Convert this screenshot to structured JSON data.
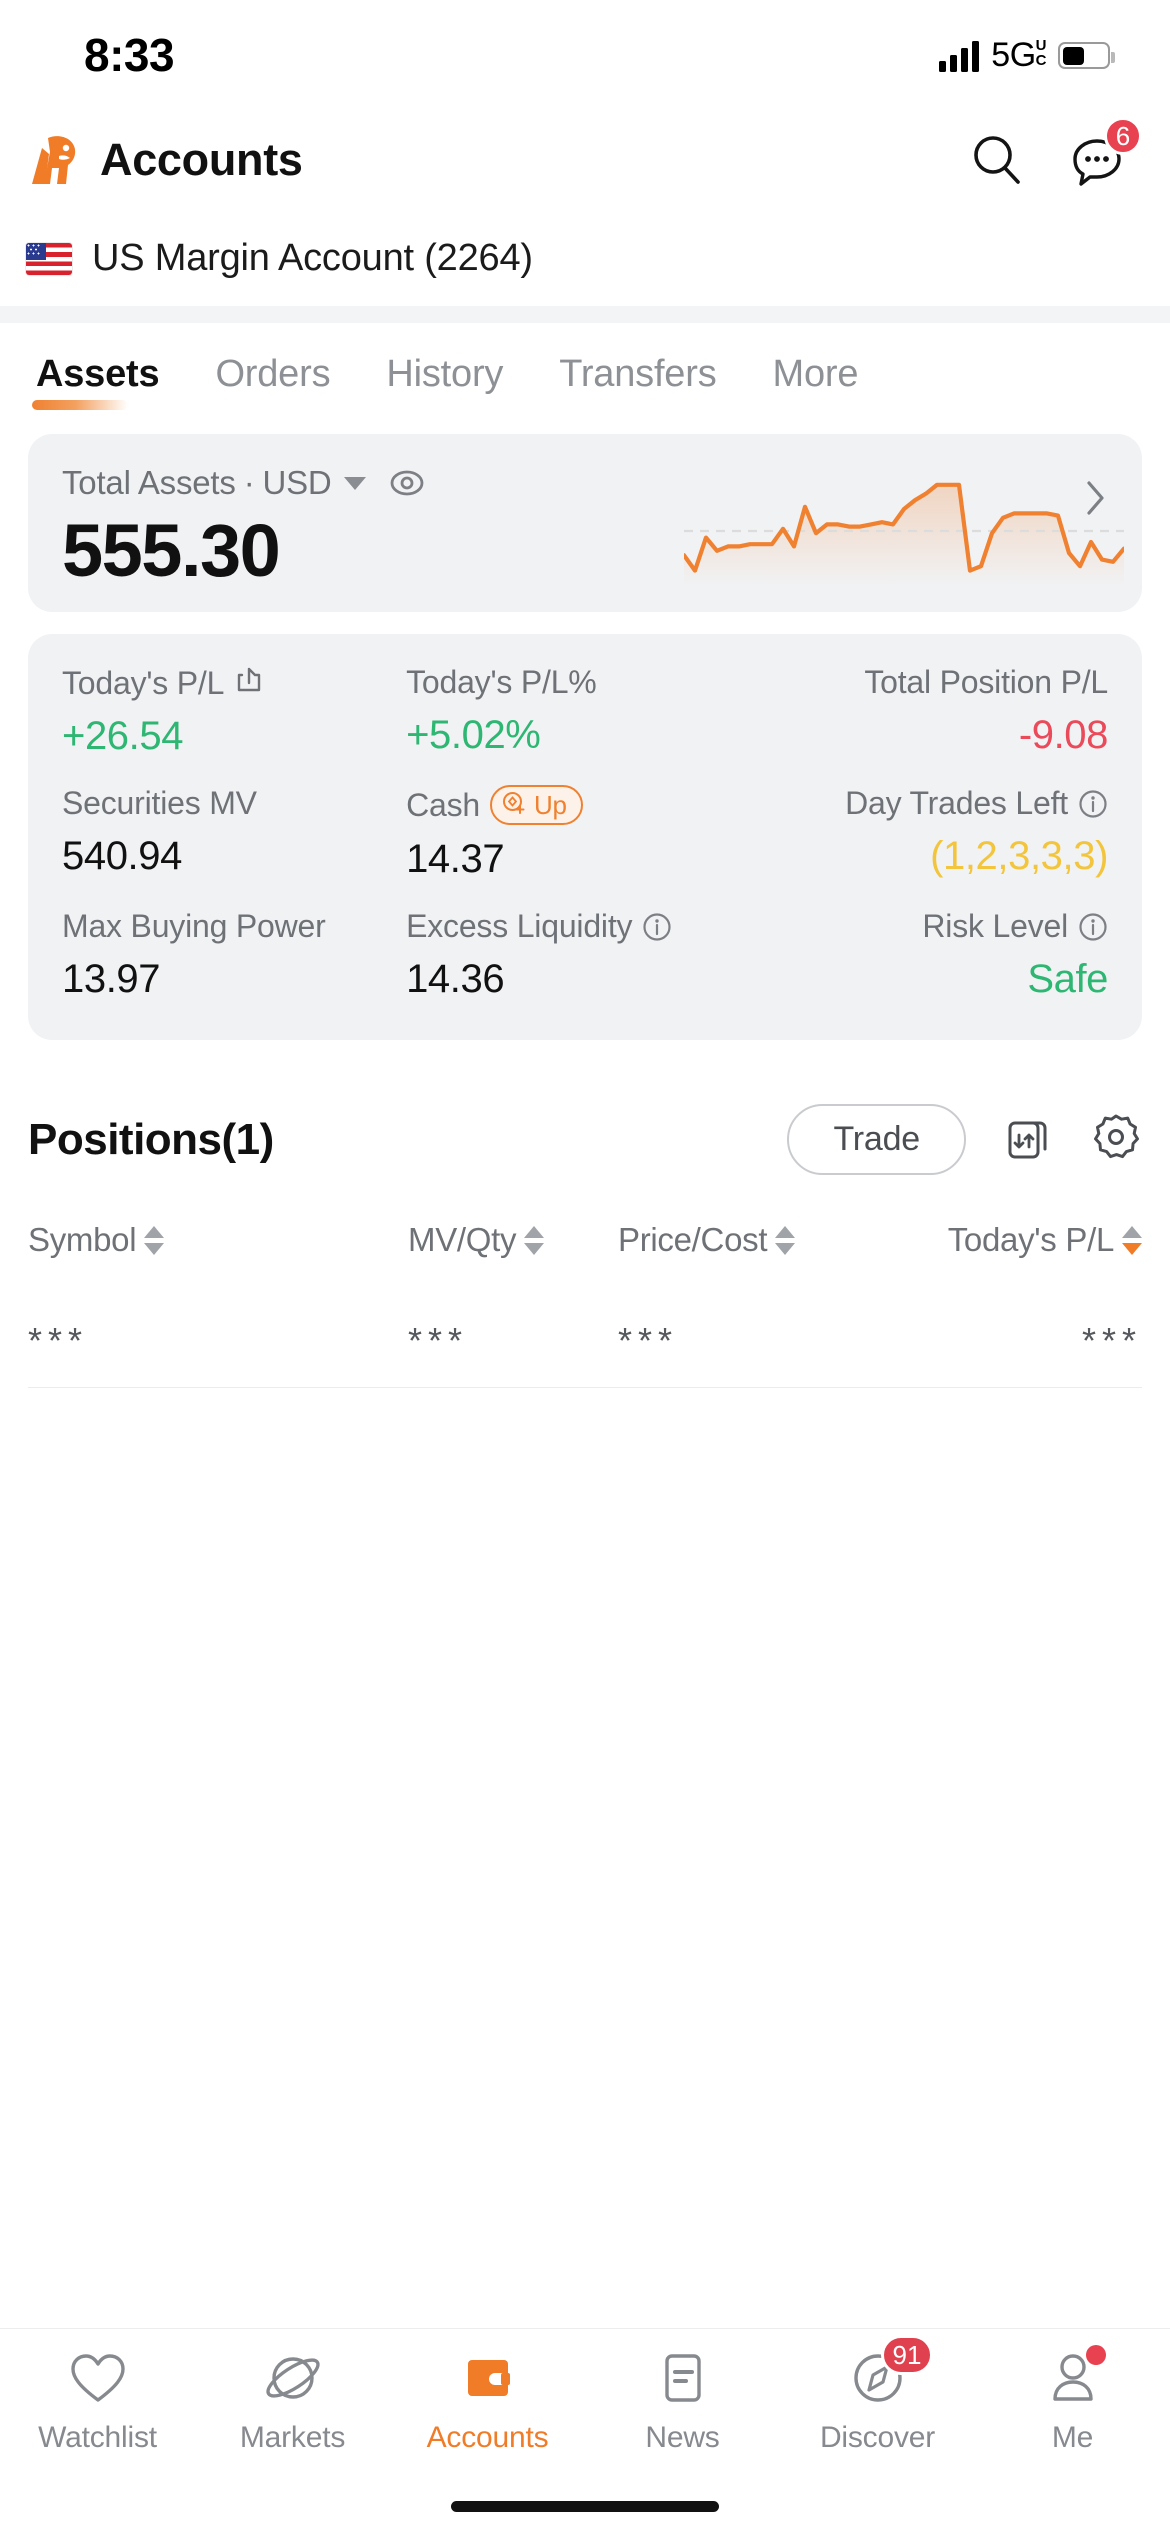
{
  "status_bar": {
    "time": "8:33",
    "network": "5G",
    "network_sup": "U",
    "network_sub": "C",
    "signal_icon": "signal-bars-icon",
    "battery_icon": "battery-icon"
  },
  "header": {
    "title": "Accounts",
    "logo_icon": "bull-logo-icon",
    "search_icon": "search-icon",
    "messages_icon": "chat-bubble-icon",
    "messages_badge": "6"
  },
  "account": {
    "flag_icon": "us-flag-icon",
    "name": "US Margin Account (2264)"
  },
  "tabs": [
    {
      "label": "Assets",
      "active": true
    },
    {
      "label": "Orders",
      "active": false
    },
    {
      "label": "History",
      "active": false
    },
    {
      "label": "Transfers",
      "active": false
    },
    {
      "label": "More",
      "active": false
    }
  ],
  "total_assets": {
    "label": "Total Assets",
    "separator": "·",
    "currency": "USD",
    "currency_caret_icon": "chevron-down-icon",
    "eye_icon": "eye-icon",
    "value": "555.30",
    "chevron_icon": "chevron-right-icon"
  },
  "chart_data": {
    "type": "line",
    "title": "Total Assets Trend",
    "xlabel": "",
    "ylabel": "",
    "grid": false,
    "legend": "none",
    "line_color": "#ef8131",
    "reference_line": {
      "style": "dashed",
      "color": "#dcdcdc",
      "value": 50
    },
    "x": [
      0,
      1,
      2,
      3,
      4,
      5,
      6,
      7,
      8,
      9,
      10,
      11,
      12,
      13,
      14,
      15,
      16,
      17,
      18,
      19,
      20,
      21,
      22,
      23,
      24,
      25,
      26,
      27,
      28,
      29,
      30,
      31,
      32,
      33,
      34,
      35,
      36,
      37,
      38,
      39,
      40
    ],
    "values": [
      28,
      14,
      44,
      32,
      36,
      36,
      38,
      38,
      38,
      52,
      36,
      72,
      48,
      56,
      56,
      54,
      54,
      56,
      58,
      56,
      70,
      78,
      84,
      92,
      92,
      92,
      14,
      18,
      48,
      62,
      66,
      66,
      66,
      66,
      64,
      30,
      18,
      40,
      24,
      22,
      34
    ],
    "ylim": [
      0,
      100
    ]
  },
  "stats": [
    [
      {
        "label": "Today's P/L",
        "icon": "share-icon",
        "value": "+26.54",
        "tone": "pos",
        "align": "left"
      },
      {
        "label": "Today's P/L%",
        "icon": null,
        "value": "+5.02%",
        "tone": "pos",
        "align": "left"
      },
      {
        "label": "Total Position P/L",
        "icon": null,
        "value": "-9.08",
        "tone": "neg",
        "align": "right"
      }
    ],
    [
      {
        "label": "Securities MV",
        "icon": null,
        "value": "540.94",
        "tone": "",
        "align": "left"
      },
      {
        "label": "Cash",
        "icon": "cash-up-badge",
        "badge_text": "Up",
        "value": "14.37",
        "tone": "",
        "align": "left"
      },
      {
        "label": "Day Trades Left",
        "icon": "info-icon",
        "value": "(1,2,3,3,3)",
        "tone": "warn",
        "align": "right"
      }
    ],
    [
      {
        "label": "Max Buying Power",
        "icon": null,
        "value": "13.97",
        "tone": "",
        "align": "left"
      },
      {
        "label": "Excess Liquidity",
        "icon": "info-icon",
        "value": "14.36",
        "tone": "",
        "align": "left"
      },
      {
        "label": "Risk Level",
        "icon": "info-icon",
        "value": "Safe",
        "tone": "safe",
        "align": "right"
      }
    ]
  ],
  "positions": {
    "title": "Positions(1)",
    "trade_button": "Trade",
    "swap_icon": "transfer-swap-icon",
    "settings_icon": "gear-icon",
    "columns": [
      {
        "label": "Symbol",
        "sort_icon": "sort-arrows-icon",
        "sort_active": false
      },
      {
        "label": "MV/Qty",
        "sort_icon": "sort-arrows-icon",
        "sort_active": false
      },
      {
        "label": "Price/Cost",
        "sort_icon": "sort-arrows-icon",
        "sort_active": false
      },
      {
        "label": "Today's P/L",
        "sort_icon": "sort-arrows-icon",
        "sort_active": true
      }
    ],
    "rows": [
      {
        "symbol": "***",
        "mv_qty": "***",
        "price_cost": "***",
        "todays_pl": "***"
      }
    ]
  },
  "bottom_nav": [
    {
      "label": "Watchlist",
      "icon": "heart-icon",
      "active": false,
      "badge": null,
      "dot": false
    },
    {
      "label": "Markets",
      "icon": "planet-icon",
      "active": false,
      "badge": null,
      "dot": false
    },
    {
      "label": "Accounts",
      "icon": "wallet-icon",
      "active": true,
      "badge": null,
      "dot": false
    },
    {
      "label": "News",
      "icon": "news-document-icon",
      "active": false,
      "badge": null,
      "dot": false
    },
    {
      "label": "Discover",
      "icon": "compass-icon",
      "active": false,
      "badge": "91",
      "dot": false
    },
    {
      "label": "Me",
      "icon": "person-icon",
      "active": false,
      "badge": null,
      "dot": true
    }
  ],
  "colors": {
    "accent": "#f07c28",
    "positive": "#2eb673",
    "negative": "#ea4a5a",
    "warning": "#f2c53d",
    "badge_red": "#e0414f",
    "card_bg": "#f1f2f4"
  }
}
